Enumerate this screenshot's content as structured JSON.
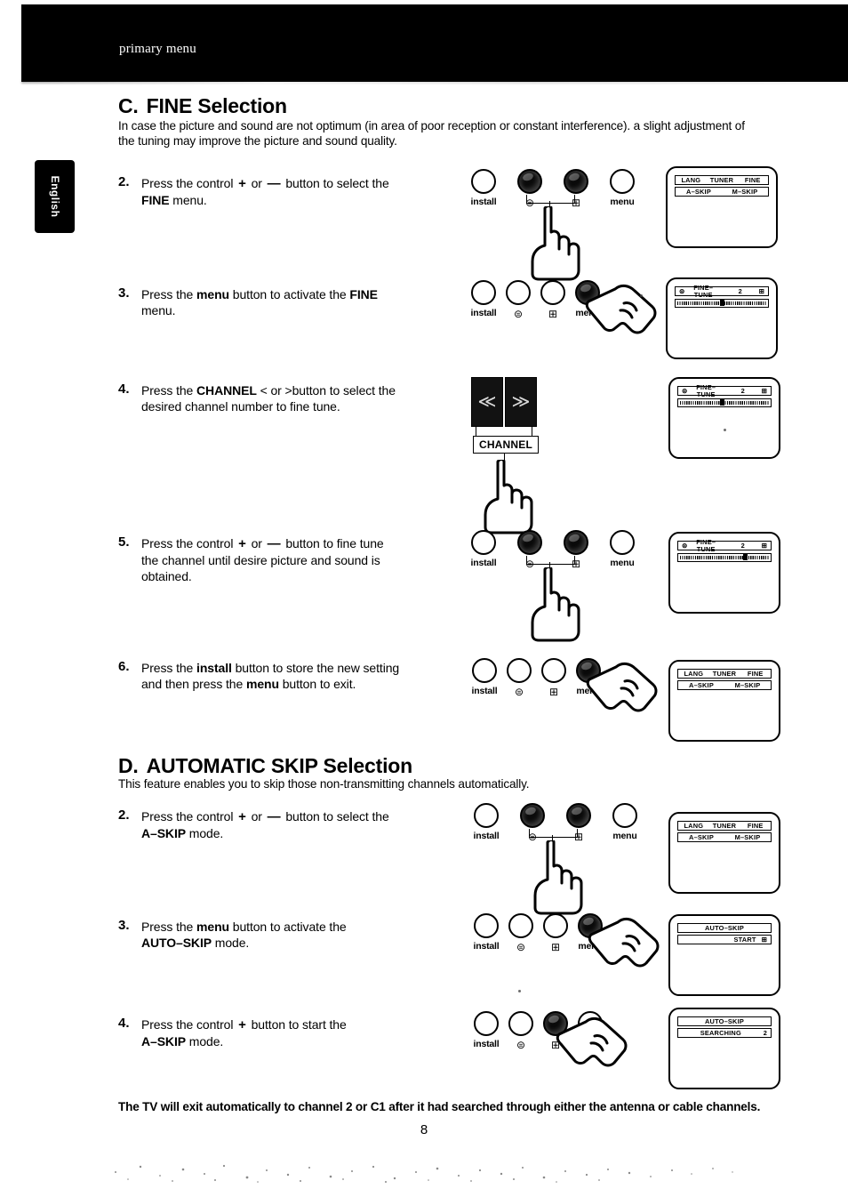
{
  "header": {
    "running_head": "primary menu"
  },
  "side_tab": {
    "label": "English"
  },
  "sections": [
    {
      "letter": "C.",
      "title": "FINE Selection",
      "intro": "In case the picture and sound are not optimum (in area of poor reception or constant interference). a slight adjustment of the tuning may improve the picture and sound quality."
    },
    {
      "letter": "D.",
      "title": "AUTOMATIC SKIP Selection",
      "intro": "This feature enables you to skip those non-transmitting channels automatically."
    }
  ],
  "steps": {
    "c2": {
      "num": "2.",
      "line1_a": "Press the control",
      "plus": "+",
      "or": "or",
      "minus": "—",
      "line1_b": "button to select the",
      "line2_bold": "FINE",
      "line2_rest": "menu."
    },
    "c3": {
      "num": "3.",
      "text_a": "Press the",
      "bold1": "menu",
      "text_b": "button to activate the",
      "bold2": "FINE",
      "line2": "menu."
    },
    "c4": {
      "num": "4.",
      "text_a": "Press the",
      "bold1": "CHANNEL",
      "lt": "<",
      "or": "or",
      "gt": ">",
      "text_b": "button to select the",
      "line2": "desired channel number to fine tune."
    },
    "c5": {
      "num": "5.",
      "line1_a": "Press the control",
      "plus": "+",
      "or": "or",
      "minus": "—",
      "line1_b": "button to fine tune",
      "line2": "the channel until desire picture and sound is",
      "line3": "obtained."
    },
    "c6": {
      "num": "6.",
      "text_a": "Press the",
      "bold1": "install",
      "text_b": "button to store the new setting",
      "line2_a": "and then press the",
      "bold2": "menu",
      "line2_b": "button to exit."
    },
    "d2": {
      "num": "2.",
      "line1_a": "Press the control",
      "plus": "+",
      "or": "or",
      "minus": "—",
      "line1_b": "button to select the",
      "line2_bold": "A–SKIP",
      "line2_rest": "mode."
    },
    "d3": {
      "num": "3.",
      "text_a": "Press the",
      "bold1": "menu",
      "text_b": "button to activate the",
      "line2_bold": "AUTO–SKIP",
      "line2_rest": "mode."
    },
    "d4": {
      "num": "4.",
      "line1_a": "Press the control",
      "plus": "+",
      "line1_b": "button to start the",
      "line2_bold": "A–SKIP",
      "line2_rest": "mode."
    }
  },
  "controls": {
    "install_label": "install",
    "menu_label": "menu",
    "left_arrow": "⊜",
    "right_arrow": "⊞",
    "channel_label": "CHANNEL",
    "channel_prev": "≪",
    "channel_next": "≫"
  },
  "screens": {
    "main_menu": {
      "row1": [
        "LANG",
        "TUNER",
        "FINE"
      ],
      "row2": [
        "A–SKIP",
        "M–SKIP"
      ]
    },
    "fine_tune_1": {
      "left_arrow": "⊜",
      "label": "FINE–TUNE",
      "value": "2",
      "right_arrow": "⊞",
      "slider_pct": 50
    },
    "fine_tune_2": {
      "left_arrow": "⊜",
      "label": "FINE–TUNE",
      "value": "2",
      "right_arrow": "⊞",
      "slider_pct": 47
    },
    "fine_tune_3": {
      "left_arrow": "⊜",
      "label": "FINE–TUNE",
      "value": "2",
      "right_arrow": "⊞",
      "slider_pct": 72
    },
    "auto_skip_start": {
      "title": "AUTO–SKIP",
      "action": "START",
      "arrow": "⊞"
    },
    "auto_skip_searching": {
      "title": "AUTO–SKIP",
      "status": "SEARCHING",
      "value": "2"
    }
  },
  "footnote": "The TV will exit automatically to channel 2 or C1 after it had searched through either the antenna or cable channels.",
  "page_number": "8"
}
